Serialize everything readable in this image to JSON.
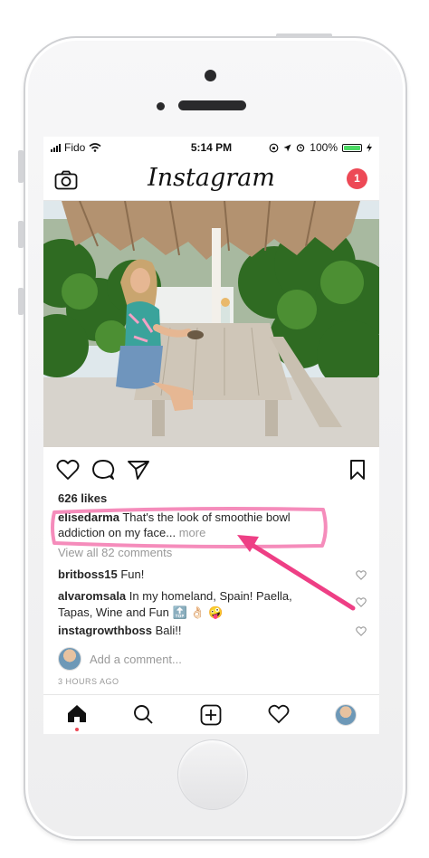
{
  "status_bar": {
    "carrier": "Fido",
    "time": "5:14 PM",
    "battery": "100%"
  },
  "header": {
    "logo": "Instagram",
    "notification_count": "1"
  },
  "post": {
    "likes": "626 likes",
    "caption_user": "elisedarma",
    "caption_text": " That's the look of smoothie bowl addiction on my face...",
    "more": "more",
    "view_all": "View all 82 comments"
  },
  "comments": [
    {
      "user": "britboss15",
      "text": " Fun!"
    },
    {
      "user": "alvaromsala",
      "text": " In my homeland, Spain! Paella, Tapas, Wine and Fun 🔝 👌🏻 🤪"
    },
    {
      "user": "instagrowthboss",
      "text": " Bali!!"
    }
  ],
  "add_comment_placeholder": "Add a comment...",
  "timestamp": "3 HOURS AGO",
  "colors": {
    "accent": "#ed4956",
    "annotation": "#f47fb4",
    "battery": "#4cd964"
  },
  "icons": [
    "camera-icon",
    "heart-icon",
    "comment-icon",
    "share-icon",
    "bookmark-icon",
    "home-icon",
    "search-icon",
    "add-icon",
    "activity-icon",
    "profile-avatar"
  ]
}
